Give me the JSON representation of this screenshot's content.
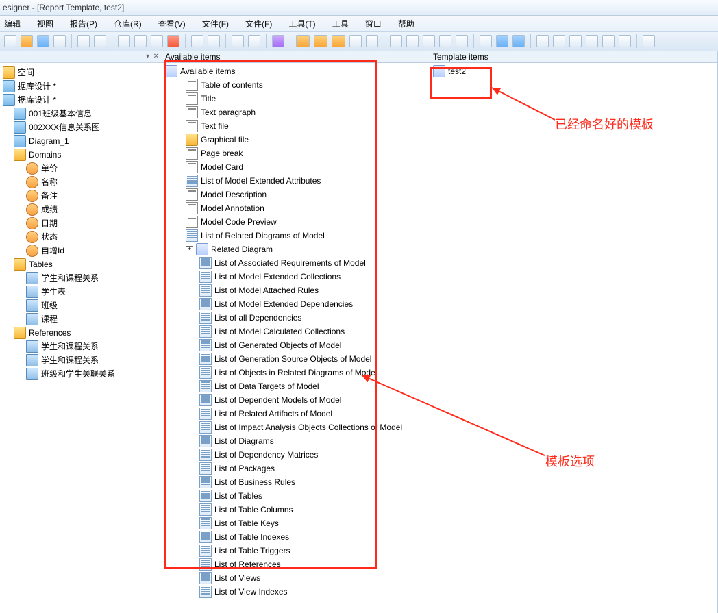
{
  "window_title": "esigner - [Report Template, test2]",
  "menus": [
    "编辑",
    "视图",
    "报告(P)",
    "仓库(R)",
    "查看(V)",
    "文件(F)",
    "文件(F)",
    "工具(T)",
    "工具",
    "窗口",
    "帮助"
  ],
  "left_tree": [
    {
      "label": "空间",
      "indent": 0,
      "icon": "folder"
    },
    {
      "label": "据库设计 *",
      "indent": 0,
      "icon": "db"
    },
    {
      "label": "据库设计 *",
      "indent": 0,
      "icon": "db"
    },
    {
      "label": "001班级基本信息",
      "indent": 1,
      "icon": "db"
    },
    {
      "label": "002XXX信息关系图",
      "indent": 1,
      "icon": "db"
    },
    {
      "label": "Diagram_1",
      "indent": 1,
      "icon": "db"
    },
    {
      "label": "Domains",
      "indent": 1,
      "icon": "folder"
    },
    {
      "label": "单价",
      "indent": 2,
      "icon": "domain"
    },
    {
      "label": "名称",
      "indent": 2,
      "icon": "domain"
    },
    {
      "label": "备注",
      "indent": 2,
      "icon": "domain"
    },
    {
      "label": "成绩",
      "indent": 2,
      "icon": "domain"
    },
    {
      "label": "日期",
      "indent": 2,
      "icon": "domain"
    },
    {
      "label": "状态",
      "indent": 2,
      "icon": "domain"
    },
    {
      "label": "自增Id",
      "indent": 2,
      "icon": "domain"
    },
    {
      "label": "Tables",
      "indent": 1,
      "icon": "folder"
    },
    {
      "label": "学生和课程关系",
      "indent": 2,
      "icon": "table"
    },
    {
      "label": "学生表",
      "indent": 2,
      "icon": "table"
    },
    {
      "label": "班级",
      "indent": 2,
      "icon": "table"
    },
    {
      "label": "课程",
      "indent": 2,
      "icon": "table"
    },
    {
      "label": "References",
      "indent": 1,
      "icon": "folder"
    },
    {
      "label": "学生和课程关系",
      "indent": 2,
      "icon": "ref"
    },
    {
      "label": "学生和课程关系",
      "indent": 2,
      "icon": "ref"
    },
    {
      "label": "班级和学生关联关系",
      "indent": 2,
      "icon": "ref"
    }
  ],
  "available_header": "Available items",
  "template_header": "Template items",
  "template_root": "test2",
  "available_root": "Available items",
  "available_items": [
    {
      "label": "Table of contents",
      "icon": "page",
      "indent": 1
    },
    {
      "label": "Title",
      "icon": "page",
      "indent": 1
    },
    {
      "label": "Text paragraph",
      "icon": "page",
      "indent": 1
    },
    {
      "label": "Text file",
      "icon": "page",
      "indent": 1
    },
    {
      "label": "Graphical file",
      "icon": "folder",
      "indent": 1
    },
    {
      "label": "Page break",
      "icon": "page",
      "indent": 1
    },
    {
      "label": "Model Card",
      "icon": "page",
      "indent": 1
    },
    {
      "label": "List of Model Extended Attributes",
      "icon": "list",
      "indent": 1
    },
    {
      "label": "Model Description",
      "icon": "page",
      "indent": 1
    },
    {
      "label": "Model Annotation",
      "icon": "page",
      "indent": 1
    },
    {
      "label": "Model Code Preview",
      "icon": "page",
      "indent": 1
    },
    {
      "label": "List of Related Diagrams of Model",
      "icon": "list",
      "indent": 1
    },
    {
      "label": "Related Diagram",
      "icon": "root",
      "indent": 1,
      "expandable": true
    },
    {
      "label": "List of Associated Requirements of Model",
      "icon": "list",
      "indent": 2
    },
    {
      "label": "List of Model Extended Collections",
      "icon": "list",
      "indent": 2
    },
    {
      "label": "List of Model Attached Rules",
      "icon": "list",
      "indent": 2
    },
    {
      "label": "List of Model Extended Dependencies",
      "icon": "list",
      "indent": 2
    },
    {
      "label": "List of all Dependencies",
      "icon": "list",
      "indent": 2
    },
    {
      "label": "List of Model Calculated Collections",
      "icon": "list",
      "indent": 2
    },
    {
      "label": "List of Generated Objects of Model",
      "icon": "list",
      "indent": 2
    },
    {
      "label": "List of Generation Source Objects of Model",
      "icon": "list",
      "indent": 2
    },
    {
      "label": "List of Objects in Related Diagrams of Model",
      "icon": "list",
      "indent": 2
    },
    {
      "label": "List of Data Targets of Model",
      "icon": "list",
      "indent": 2
    },
    {
      "label": "List of Dependent Models of Model",
      "icon": "list",
      "indent": 2
    },
    {
      "label": "List of Related Artifacts of Model",
      "icon": "list",
      "indent": 2
    },
    {
      "label": "List of Impact Analysis Objects Collections of Model",
      "icon": "list",
      "indent": 2
    },
    {
      "label": "List of Diagrams",
      "icon": "list",
      "indent": 2
    },
    {
      "label": "List of Dependency Matrices",
      "icon": "list",
      "indent": 2
    },
    {
      "label": "List of Packages",
      "icon": "list",
      "indent": 2
    },
    {
      "label": "List of Business Rules",
      "icon": "list",
      "indent": 2
    },
    {
      "label": "List of Tables",
      "icon": "list",
      "indent": 2
    },
    {
      "label": "List of Table Columns",
      "icon": "list",
      "indent": 2
    },
    {
      "label": "List of Table Keys",
      "icon": "list",
      "indent": 2
    },
    {
      "label": "List of Table Indexes",
      "icon": "list",
      "indent": 2
    },
    {
      "label": "List of Table Triggers",
      "icon": "list",
      "indent": 2
    },
    {
      "label": "List of References",
      "icon": "list",
      "indent": 2
    },
    {
      "label": "List of Views",
      "icon": "list",
      "indent": 2
    },
    {
      "label": "List of View Indexes",
      "icon": "list",
      "indent": 2
    }
  ],
  "annotations": {
    "template_label": "已经命名好的模板",
    "options_label": "模板选项"
  }
}
